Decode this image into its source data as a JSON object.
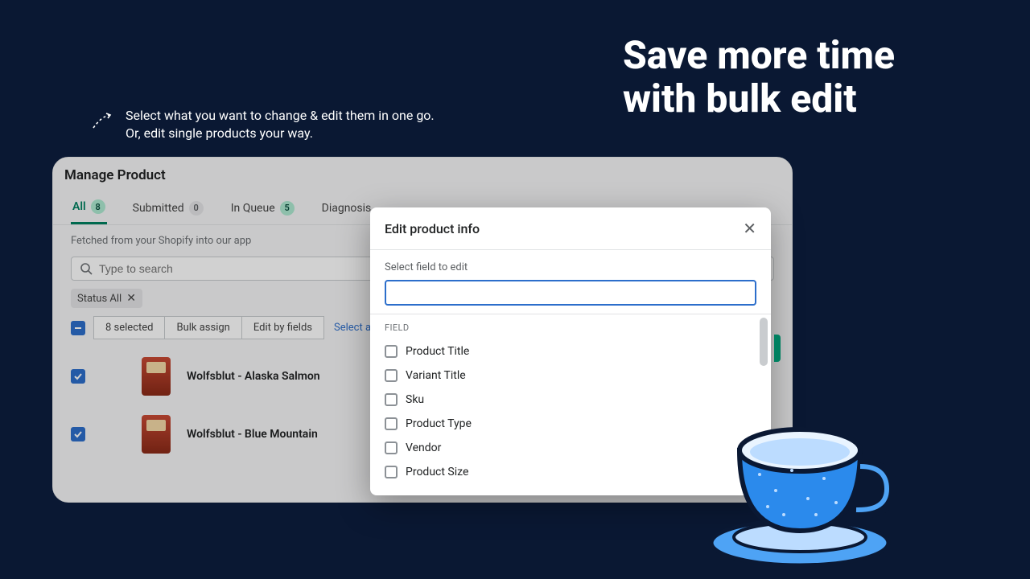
{
  "headline_line1": "Save more time",
  "headline_line2": "with bulk edit",
  "lead_line1": "Select what you want to change & edit them in one go.",
  "lead_line2": "Or, edit single products your way.",
  "window_title": "Manage Product",
  "tabs": {
    "all": {
      "label": "All",
      "count": "8"
    },
    "submitted": {
      "label": "Submitted",
      "count": "0"
    },
    "queue": {
      "label": "In Queue",
      "count": "5"
    },
    "diagnosis": {
      "label": "Diagnosis"
    }
  },
  "subtext": "Fetched from your Shopify into our app",
  "search_placeholder": "Type to search",
  "chip_label": "Status All",
  "toolbar": {
    "selected_label": "8 selected",
    "bulk_assign": "Bulk assign",
    "edit_by_fields": "Edit by fields",
    "select_all": "Select all products"
  },
  "rows": [
    {
      "title": "Wolfsblut - Alaska Salmon"
    },
    {
      "title": "Wolfsblut - Blue Mountain"
    }
  ],
  "modal": {
    "title": "Edit product info",
    "field_label": "Select field to edit",
    "section": "FIELD",
    "options": [
      "Product Title",
      "Variant Title",
      "Sku",
      "Product Type",
      "Vendor",
      "Product Size"
    ]
  }
}
